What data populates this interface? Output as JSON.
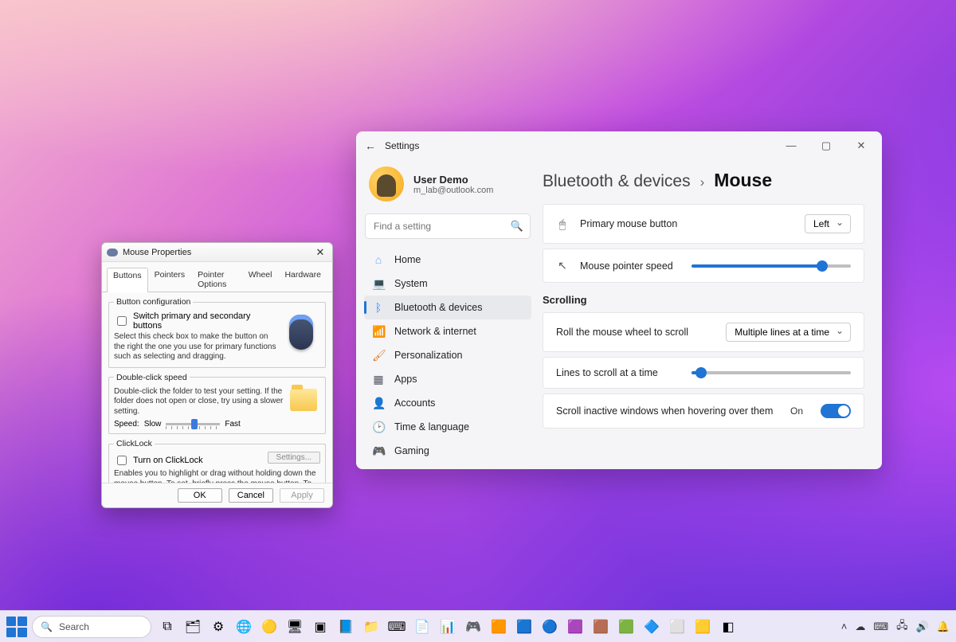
{
  "settings": {
    "title": "Settings",
    "user": {
      "name": "User Demo",
      "email": "m_lab@outlook.com"
    },
    "search_placeholder": "Find a setting",
    "nav": {
      "home": "Home",
      "system": "System",
      "bluetooth": "Bluetooth & devices",
      "network": "Network & internet",
      "personalization": "Personalization",
      "apps": "Apps",
      "accounts": "Accounts",
      "time": "Time & language",
      "gaming": "Gaming"
    },
    "breadcrumb": {
      "parent": "Bluetooth & devices",
      "current": "Mouse"
    },
    "rows": {
      "primary_button": {
        "label": "Primary mouse button",
        "value": "Left"
      },
      "pointer_speed": {
        "label": "Mouse pointer speed",
        "percent": 82
      },
      "scroll_heading": "Scrolling",
      "wheel_scroll": {
        "label": "Roll the mouse wheel to scroll",
        "value": "Multiple lines at a time"
      },
      "lines": {
        "label": "Lines to scroll at a time",
        "percent": 6
      },
      "inactive": {
        "label": "Scroll inactive windows when hovering over them",
        "state": "On"
      }
    }
  },
  "mouse_props": {
    "title": "Mouse Properties",
    "tabs": {
      "buttons": "Buttons",
      "pointers": "Pointers",
      "pointer_options": "Pointer Options",
      "wheel": "Wheel",
      "hardware": "Hardware"
    },
    "button_cfg": {
      "legend": "Button configuration",
      "checkbox": "Switch primary and secondary buttons",
      "help": "Select this check box to make the button on the right the one you use for primary functions such as selecting and dragging."
    },
    "dbl": {
      "legend": "Double-click speed",
      "help": "Double-click the folder to test your setting. If the folder does not open or close, try using a slower setting.",
      "speed_label": "Speed:",
      "slow": "Slow",
      "fast": "Fast"
    },
    "clicklock": {
      "legend": "ClickLock",
      "checkbox": "Turn on ClickLock",
      "settings_btn": "Settings...",
      "help": "Enables you to highlight or drag without holding down the mouse button. To set, briefly press the mouse button. To release, click the mouse button again."
    },
    "footer": {
      "ok": "OK",
      "cancel": "Cancel",
      "apply": "Apply"
    }
  },
  "taskbar": {
    "search": "Search"
  }
}
